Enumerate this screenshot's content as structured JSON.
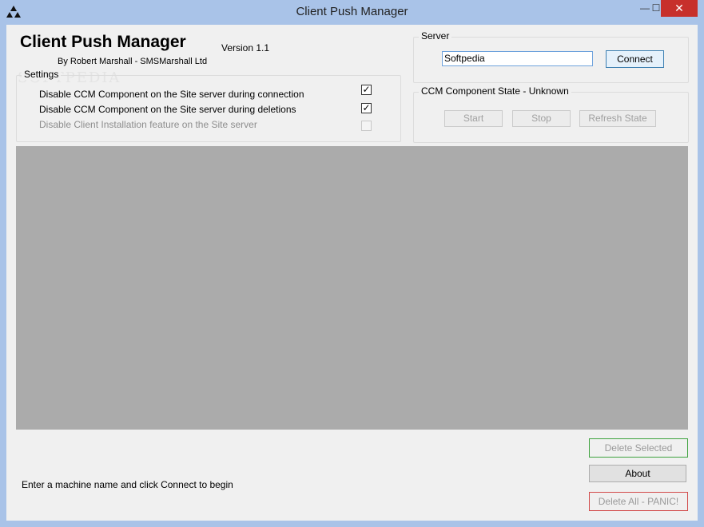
{
  "window": {
    "title": "Client Push Manager",
    "app_icon": "triforce-app-icon",
    "controls": {
      "minimize": "—",
      "maximize": "☐",
      "close": "✕"
    }
  },
  "header": {
    "app_title": "Client Push Manager",
    "version": "Version 1.1",
    "author": "By Robert Marshall - SMSMarshall Ltd",
    "watermark": "SOFTPEDIA"
  },
  "settings": {
    "label": "Settings",
    "options": [
      {
        "label": "Disable CCM Component on the Site server during connection",
        "checked": true,
        "enabled": true
      },
      {
        "label": "Disable CCM Component on the Site server during deletions",
        "checked": true,
        "enabled": true
      },
      {
        "label": "Disable Client Installation feature on the Site server",
        "checked": false,
        "enabled": false
      }
    ]
  },
  "server": {
    "label": "Server",
    "value": "Softpedia",
    "connect_label": "Connect"
  },
  "ccm": {
    "label": "CCM Component State - Unknown",
    "start_label": "Start",
    "stop_label": "Stop",
    "refresh_label": "Refresh State"
  },
  "actions": {
    "delete_selected": "Delete Selected",
    "about": "About",
    "delete_all": "Delete All - PANIC!"
  },
  "status": {
    "text": "Enter a machine name and click Connect to begin"
  }
}
